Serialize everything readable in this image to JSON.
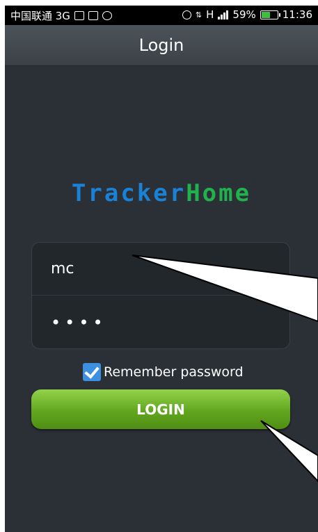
{
  "status_bar": {
    "carrier": "中国联通 3G",
    "network_marker": "H",
    "battery": "59%",
    "battery_level": 0.59,
    "time": "11:36",
    "icons": [
      "image-icon",
      "gallery-icon",
      "notification-icon",
      "alarm-icon",
      "data-arrows-icon",
      "signal-icon",
      "battery-icon"
    ]
  },
  "header": {
    "title": "Login"
  },
  "logo": {
    "part1": "Tracker",
    "part2": "Home",
    "color1": "#1a82d6",
    "color2": "#21b24e"
  },
  "form": {
    "username": "mc",
    "password_masked": "••••",
    "remember_label": "Remember password",
    "remember_checked": true
  },
  "login_button": {
    "label": "LOGIN"
  },
  "colors": {
    "background": "#2b3036",
    "accent": "#3d8fe0",
    "button": "#62a61f"
  }
}
